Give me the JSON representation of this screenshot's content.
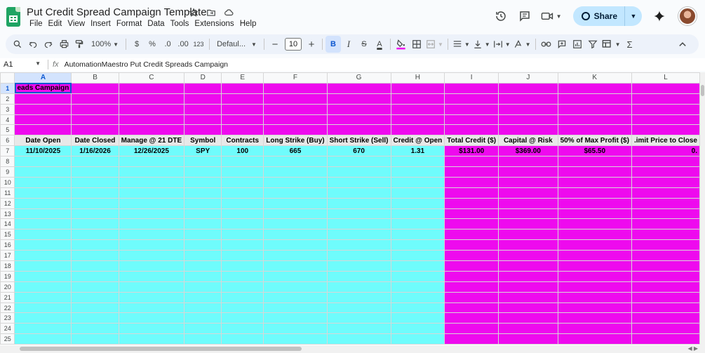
{
  "app": {
    "doc_title": "Put Credit Spread Campaign Template",
    "menus": [
      "File",
      "Edit",
      "View",
      "Insert",
      "Format",
      "Data",
      "Tools",
      "Extensions",
      "Help"
    ],
    "share_label": "Share"
  },
  "toolbar": {
    "zoom": "100%",
    "currency": "$",
    "percent": "%",
    "decrease_decimal": ".0",
    "increase_decimal": ".00",
    "number_format": "123",
    "font": "Defaul...",
    "font_size": "10",
    "bold": "B",
    "italic": "I",
    "strikethrough": "S",
    "text_color": "A",
    "sum": "Σ"
  },
  "formula_bar": {
    "cell_ref": "A1",
    "fx": "fx",
    "content": "AutomationMaestro Put Credit Spreads Campaign"
  },
  "sheet": {
    "columns": [
      "A",
      "B",
      "C",
      "D",
      "E",
      "F",
      "G",
      "H",
      "I",
      "J",
      "K",
      "L"
    ],
    "rows": [
      "1",
      "2",
      "3",
      "4",
      "5",
      "6",
      "7",
      "8",
      "9",
      "10",
      "11",
      "12",
      "13",
      "14",
      "15",
      "16",
      "17",
      "18",
      "19",
      "20",
      "21",
      "22",
      "23",
      "24",
      "25"
    ],
    "a1_visible_text": "eads Campaign",
    "headers": [
      "Date Open",
      "Date Closed",
      "Manage @ 21 DTE",
      "Symbol",
      "Contracts",
      "Long Strike (Buy)",
      "Short Strike (Sell)",
      "Credit @ Open",
      "Total Credit ($)",
      "Capital @ Risk",
      "50% of Max Profit ($)",
      ".imit Price to Close"
    ],
    "row7": [
      "11/10/2025",
      "1/16/2026",
      "12/26/2025",
      "SPY",
      "100",
      "665",
      "670",
      "1.31",
      "$131.00",
      "$369.00",
      "$65.50",
      "0."
    ]
  },
  "colors": {
    "cyan_fill": "#6ffcfc",
    "magenta_fill": "#ee0aee",
    "header_fill": "#e8e8e8",
    "selection": "#0b57d0"
  }
}
